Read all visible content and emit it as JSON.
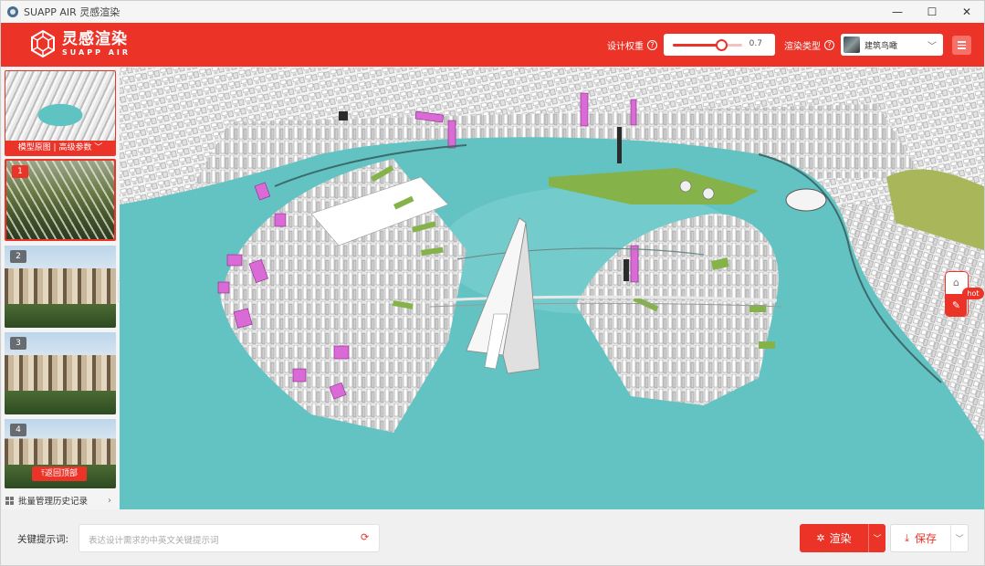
{
  "window": {
    "title": "SUAPP AIR 灵感渲染",
    "minimize": "—",
    "maximize": "☐",
    "close": "✕"
  },
  "brand": {
    "name_cn": "灵感渲染",
    "name_en": "SUAPP AIR"
  },
  "header": {
    "weight_label": "设计权重",
    "weight_value": "0.7",
    "weight_fraction": 0.7,
    "render_type_label": "渲染类型",
    "render_type_value": "建筑鸟瞰",
    "help_glyph": "?"
  },
  "sidebar": {
    "model_thumb_label": "模型原图 | 高级参数 ﹀",
    "items": [
      {
        "badge": "1",
        "selected": true
      },
      {
        "badge": "2",
        "selected": false
      },
      {
        "badge": "3",
        "selected": false
      },
      {
        "badge": "4",
        "selected": false
      }
    ],
    "back_to_top": "⤒返回顶部",
    "history_label": "批量管理历史记录",
    "history_chevron": "›",
    "collapse_glyph": "◂"
  },
  "canvas": {
    "hot_badge": "hot",
    "home_glyph": "⌂",
    "edit_glyph": "✎"
  },
  "bottom": {
    "keyword_label": "关键提示词:",
    "keyword_placeholder": "表达设计需求的中英文关键提示词",
    "keyword_value": "",
    "render_button": "渲染",
    "save_button": "保存",
    "render_glyph": "✲",
    "save_glyph": "⤓",
    "dropdown_glyph": "﹀"
  },
  "colors": {
    "accent": "#ec3328",
    "water": "#63c3c2",
    "highlight_building": "#d96ad6",
    "green_roof": "#86b24a"
  }
}
